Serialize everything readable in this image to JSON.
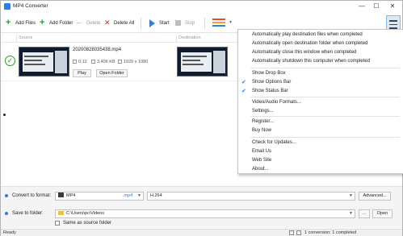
{
  "app": {
    "title": "MP4 Converter"
  },
  "window_controls": {
    "minimize": "—",
    "maximize": "☐",
    "close": "✕"
  },
  "toolbar": {
    "add_files": "Add Files",
    "add_folder": "Add Folder",
    "delete": "Delete",
    "delete_all": "Delete All",
    "start": "Start",
    "stop": "Stop",
    "profile_colors": [
      "#e14b3b",
      "#f0a22a",
      "#2f7fd8"
    ]
  },
  "list": {
    "source_header": "Source",
    "destination_header": "Destination",
    "item": {
      "filename": "20200828035438.mp4",
      "duration": "0:12",
      "size": "3,406 KB",
      "resolution": "1920 x 1080",
      "play_label": "Play",
      "open_folder_label": "Open Folder"
    }
  },
  "menu": {
    "items": [
      {
        "label": "Automatically play destination files when completed",
        "checked": false
      },
      {
        "label": "Automatically open destination folder when completed",
        "checked": false
      },
      {
        "label": "Automatically close this window when completed",
        "checked": false
      },
      {
        "label": "Automatically shutdown this computer when completed",
        "checked": false
      },
      {
        "label": "Show Drop Box",
        "checked": false
      },
      {
        "label": "Show Options Bar",
        "checked": true
      },
      {
        "label": "Show Status Bar",
        "checked": true
      },
      {
        "label": "Video/Audio Formats...",
        "checked": false
      },
      {
        "label": "Settings...",
        "checked": false
      },
      {
        "label": "Register...",
        "checked": false
      },
      {
        "label": "Buy Now",
        "checked": false
      },
      {
        "label": "Check for Updates...",
        "checked": false
      },
      {
        "label": "Email Us",
        "checked": false
      },
      {
        "label": "Web Site",
        "checked": false
      },
      {
        "label": "About...",
        "checked": false
      }
    ]
  },
  "options": {
    "convert_label": "Convert to format:",
    "format_value": "MP4",
    "format_ext": ".mp4",
    "codec_value": "H.264",
    "advanced_label": "Advanced...",
    "save_label": "Save to folder:",
    "folder_value": "C:\\Users\\pc\\Videos",
    "browse_label": "...",
    "open_label": "Open",
    "same_as_source": "Same as source folder"
  },
  "status": {
    "left": "Ready",
    "right": "1 conversion: 1 completed"
  }
}
